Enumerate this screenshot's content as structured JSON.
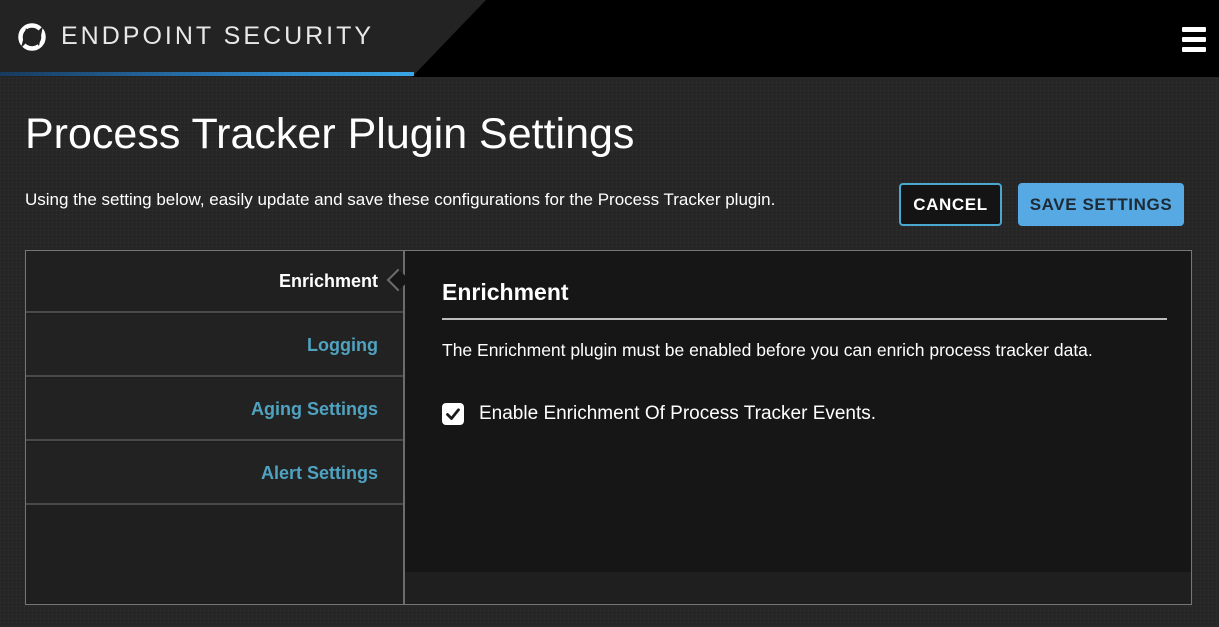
{
  "app": {
    "brand": "ENDPOINT SECURITY",
    "accent_color": "#3aa6e6"
  },
  "header": {
    "title": "Process Tracker Plugin Settings",
    "description": "Using the setting below, easily update and save these configurations for the Process Tracker plugin.",
    "cancel_label": "CANCEL",
    "save_label": "SAVE SETTINGS"
  },
  "nav": {
    "items": [
      {
        "label": "Enrichment",
        "active": true
      },
      {
        "label": "Logging",
        "active": false
      },
      {
        "label": "Aging Settings",
        "active": false
      },
      {
        "label": "Alert Settings",
        "active": false
      }
    ]
  },
  "content": {
    "section_title": "Enrichment",
    "note": "The Enrichment plugin must be enabled before you can enrich process tracker data.",
    "checkbox": {
      "label": "Enable Enrichment Of Process Tracker Events.",
      "checked": true
    }
  },
  "icons": {
    "logo": "endpoint-logo-icon",
    "menu": "hamburger-menu-icon",
    "check": "checkmark-icon"
  }
}
